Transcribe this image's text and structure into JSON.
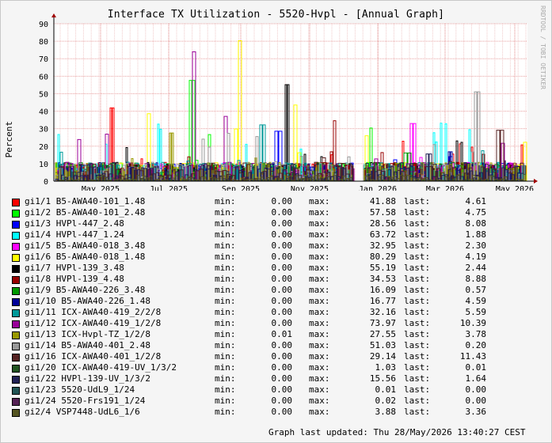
{
  "title": "Interface TX Utilization - 5520-Hvpl - [Annual Graph]",
  "watermark": "RRDTOOL / TOBI OETIKER",
  "labels": {
    "min": "min:",
    "max": "max:",
    "last": "last:"
  },
  "updated": "Graph last updated: Thu 28/May/2026 13:40:27 CEST",
  "chart_data": {
    "type": "line",
    "title": "Interface TX Utilization - 5520-Hvpl - [Annual Graph]",
    "ylabel": "Percent",
    "xlabel": "",
    "ylim": [
      0,
      90
    ],
    "yticks": [
      0,
      10,
      20,
      30,
      40,
      50,
      60,
      70,
      80,
      90
    ],
    "xticks": [
      "May 2025",
      "Jul 2025",
      "Sep 2025",
      "Nov 2025",
      "Jan 2026",
      "Mar 2026",
      "May 2026"
    ],
    "grid": true,
    "legend_position": "bottom",
    "series": [
      {
        "name": "gi1/1 B5-AWA40-101_1.48",
        "color": "#ff0000",
        "min": "0.00",
        "max": "41.88",
        "last": "4.61"
      },
      {
        "name": "gi1/2 B5-AWA40-101_2.48",
        "color": "#00ff00",
        "min": "0.00",
        "max": "57.58",
        "last": "4.75"
      },
      {
        "name": "gi1/3 HVPl-447_2.48",
        "color": "#0000ff",
        "min": "0.00",
        "max": "28.56",
        "last": "8.08"
      },
      {
        "name": "gi1/4 HVPl-447_1.24",
        "color": "#00ffff",
        "min": "0.00",
        "max": "63.72",
        "last": "1.88"
      },
      {
        "name": "gi1/5 B5-AWA40-018_3.48",
        "color": "#ff00ff",
        "min": "0.00",
        "max": "32.95",
        "last": "2.30"
      },
      {
        "name": "gi1/6 B5-AWA40-018_1.48",
        "color": "#ffff00",
        "min": "0.00",
        "max": "80.29",
        "last": "4.19"
      },
      {
        "name": "gi1/7 HVPl-139_3.48",
        "color": "#000000",
        "min": "0.00",
        "max": "55.19",
        "last": "2.44"
      },
      {
        "name": "gi1/8 HVPl-139_4.48",
        "color": "#990000",
        "min": "0.00",
        "max": "34.53",
        "last": "8.88"
      },
      {
        "name": "gi1/9 B5-AWA40-226_3.48",
        "color": "#009900",
        "min": "0.00",
        "max": "16.09",
        "last": "0.57"
      },
      {
        "name": "gi1/10 B5-AWA40-226_1.48",
        "color": "#000099",
        "min": "0.00",
        "max": "16.77",
        "last": "4.59"
      },
      {
        "name": "gi1/11 ICX-AWA40-419_2/2/8",
        "color": "#009999",
        "min": "0.00",
        "max": "32.16",
        "last": "5.59"
      },
      {
        "name": "gi1/12 ICX-AWA40-419_1/2/8",
        "color": "#990099",
        "min": "0.00",
        "max": "73.97",
        "last": "10.39"
      },
      {
        "name": "gi1/13 ICX-Hvpl-TZ_1/2/8",
        "color": "#999900",
        "min": "0.01",
        "max": "27.55",
        "last": "3.78"
      },
      {
        "name": "gi1/14 B5-AWA40-401_2.48",
        "color": "#999999",
        "min": "0.00",
        "max": "51.03",
        "last": "0.20"
      },
      {
        "name": "gi1/16 ICX-AWA40-401_1/2/8",
        "color": "#552222",
        "min": "0.00",
        "max": "29.14",
        "last": "11.43"
      },
      {
        "name": "gi1/20 ICX-AWA40-419-UV_1/3/2",
        "color": "#225522",
        "min": "0.00",
        "max": "1.03",
        "last": "0.01"
      },
      {
        "name": "gi1/22 HVPl-139-UV_1/3/2",
        "color": "#222255",
        "min": "0.00",
        "max": "15.56",
        "last": "1.64"
      },
      {
        "name": "gi1/23 5520-UdL9_1/24",
        "color": "#225555",
        "min": "0.00",
        "max": "0.01",
        "last": "0.00"
      },
      {
        "name": "gi1/24 5520-Frs191_1/24",
        "color": "#552255",
        "min": "0.00",
        "max": "0.02",
        "last": "0.00"
      },
      {
        "name": "gi2/4 VSP7448-UdL6_1/6",
        "color": "#555522",
        "min": "0.00",
        "max": "3.88",
        "last": "3.36"
      }
    ]
  }
}
